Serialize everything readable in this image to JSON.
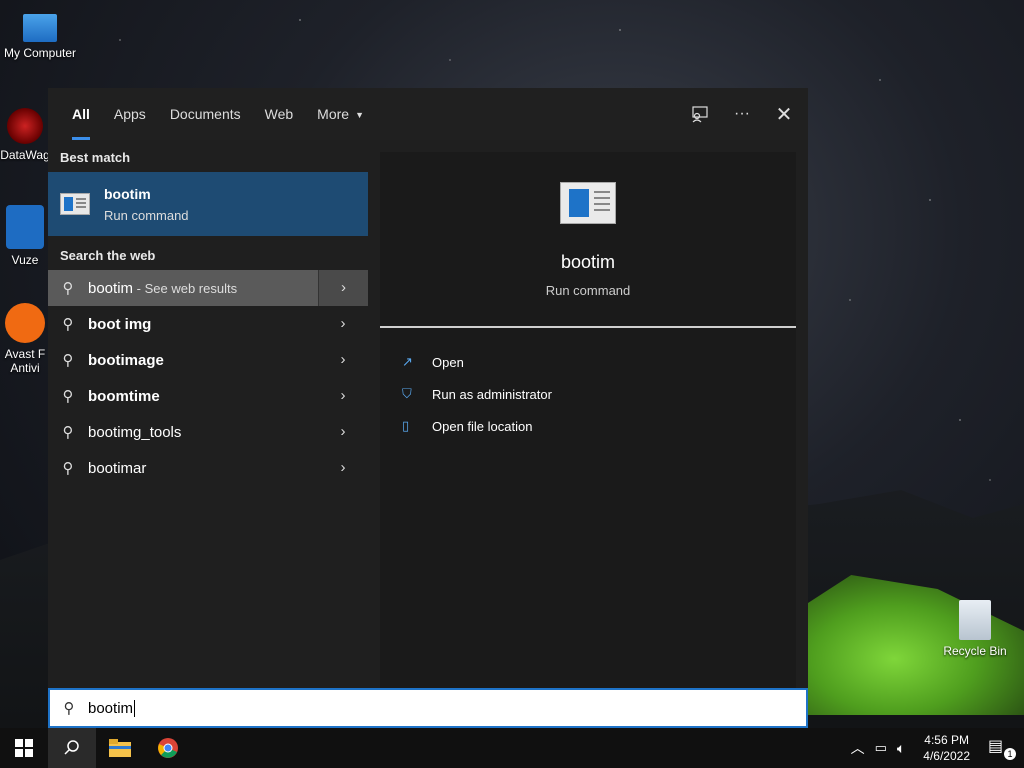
{
  "desktop": {
    "icons": [
      {
        "label": "My Computer"
      },
      {
        "label": "DataWag"
      },
      {
        "label": "Vuze"
      },
      {
        "label": "Avast F Antivi"
      },
      {
        "label": "Recycle Bin"
      }
    ]
  },
  "search_panel": {
    "tabs": [
      "All",
      "Apps",
      "Documents",
      "Web",
      "More"
    ],
    "active_tab": "All",
    "best_match": {
      "heading": "Best match",
      "name": "bootim",
      "type": "Run command"
    },
    "web": {
      "heading": "Search the web",
      "items": [
        {
          "query": "bootim",
          "suffix": " - See web results"
        },
        {
          "query": "boot img",
          "suffix": ""
        },
        {
          "query": "bootimage",
          "suffix": ""
        },
        {
          "query": "boomtime",
          "suffix": ""
        },
        {
          "query": "bootimg_tools",
          "suffix": ""
        },
        {
          "query": "bootimar",
          "suffix": ""
        }
      ]
    },
    "preview": {
      "title": "bootim",
      "subtitle": "Run command",
      "actions": [
        "Open",
        "Run as administrator",
        "Open file location"
      ]
    }
  },
  "search_box": {
    "value": "bootim"
  },
  "taskbar": {
    "time": "4:56 PM",
    "date": "4/6/2022",
    "notification_count": "1"
  },
  "colors": {
    "accent": "#1e73c8",
    "best_match_bg": "#1e4b73"
  }
}
